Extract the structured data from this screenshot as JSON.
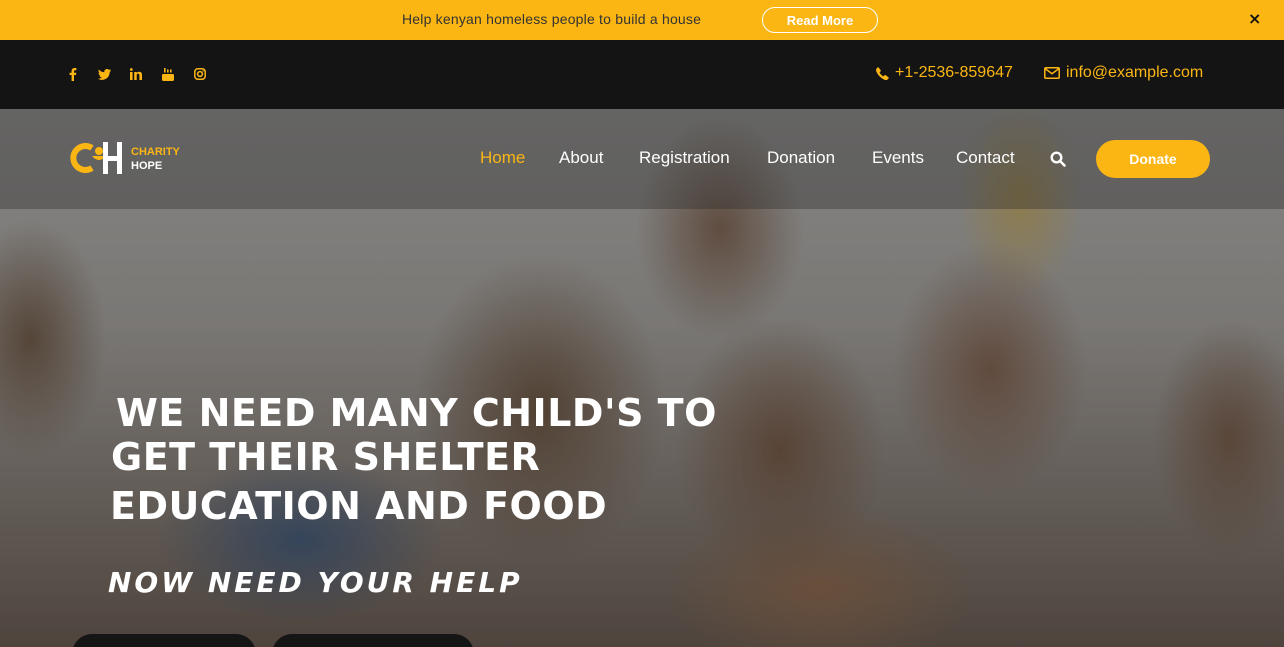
{
  "announcement": {
    "text": "Help kenyan homeless people to build a house",
    "button": "Read More",
    "close": "×"
  },
  "topbar": {
    "social": [
      "facebook-icon",
      "twitter-icon",
      "linkedin-icon",
      "youtube-icon",
      "instagram-icon"
    ],
    "phone": "+1-2536-859647",
    "email": "info@example.com"
  },
  "logo": {
    "line1": "CHARITY",
    "line2": "HOPE"
  },
  "nav": {
    "items": [
      "Home",
      "About",
      "Registration",
      "Donation",
      "Events",
      "Contact"
    ],
    "active": "Home",
    "donate": "Donate"
  },
  "hero": {
    "line1": "WE NEED MANY CHILD'S TO",
    "line2": "GET THEIR SHELTER",
    "line3": "EDUCATION AND FOOD",
    "subtitle": "NOW NEED YOUR HELP"
  },
  "colors": {
    "accent": "#fbb614",
    "dark": "#141414"
  }
}
